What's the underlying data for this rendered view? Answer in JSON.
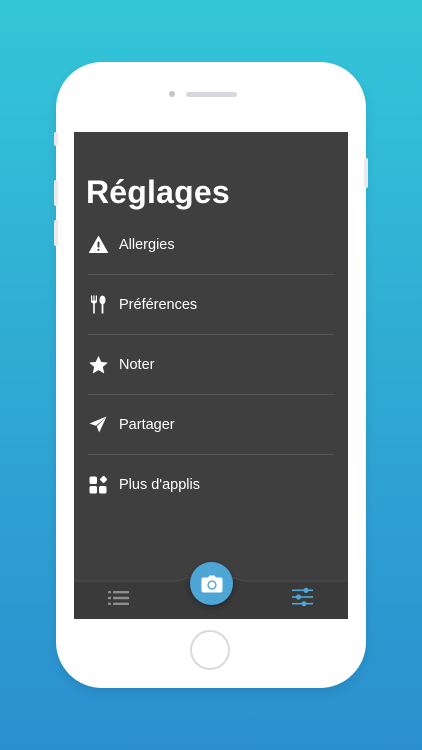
{
  "screen": {
    "title": "Réglages"
  },
  "menu": {
    "items": [
      {
        "label": "Allergies",
        "icon": "warning-icon"
      },
      {
        "label": "Préférences",
        "icon": "fork-knife-icon"
      },
      {
        "label": "Noter",
        "icon": "star-icon"
      },
      {
        "label": "Partager",
        "icon": "paper-plane-icon"
      },
      {
        "label": "Plus d'applis",
        "icon": "apps-grid-icon"
      }
    ]
  },
  "tabbar": {
    "left_icon": "list-icon",
    "center_icon": "camera-icon",
    "right_icon": "sliders-icon",
    "active": "sliders-icon"
  },
  "colors": {
    "background_top": "#33c6d8",
    "background_bottom": "#2b8fcf",
    "screen_bg": "#3f3f3f",
    "accent": "#4ea6d6",
    "text": "#ffffff",
    "inactive_icon": "#8c8c8c"
  }
}
